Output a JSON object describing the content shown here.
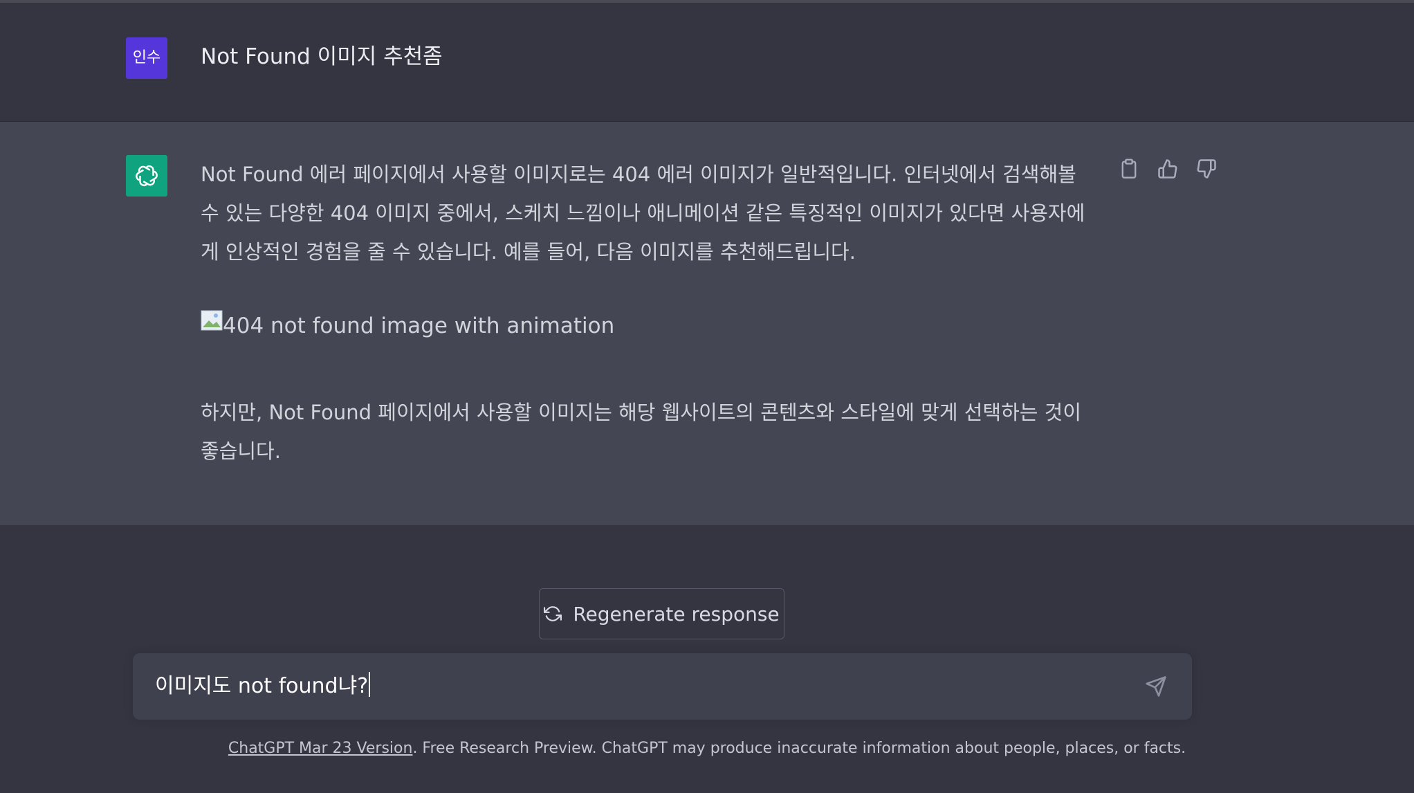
{
  "user_message": {
    "avatar_initials": "인수",
    "avatar_color": "#5436da",
    "text": "Not Found 이미지 추천좀"
  },
  "assistant_message": {
    "avatar_color": "#10a37f",
    "avatar_icon": "openai-logo-icon",
    "paragraph1": "Not Found 에러 페이지에서 사용할 이미지로는 404 에러 이미지가 일반적입니다. 인터넷에서 검색해볼 수 있는 다양한 404 이미지 중에서, 스케치 느낌이나 애니메이션 같은 특징적인 이미지가 있다면 사용자에게 인상적인 경험을 줄 수 있습니다. 예를 들어, 다음 이미지를 추천해드립니다.",
    "image_alt": "404 not found image with animation",
    "paragraph2": "하지만, Not Found 페이지에서 사용할 이미지는 해당 웹사이트의 콘텐츠와 스타일에 맞게 선택하는 것이 좋습니다.",
    "actions": [
      "copy-icon",
      "thumbs-up-icon",
      "thumbs-down-icon"
    ]
  },
  "regenerate": {
    "label": "Regenerate response",
    "icon": "refresh-icon"
  },
  "composer": {
    "value": "이미지도 not found냐?",
    "send_icon": "send-icon"
  },
  "footer": {
    "link_text": "ChatGPT Mar 23 Version",
    "text": ". Free Research Preview. ChatGPT may produce inaccurate information about people, places, or facts."
  }
}
